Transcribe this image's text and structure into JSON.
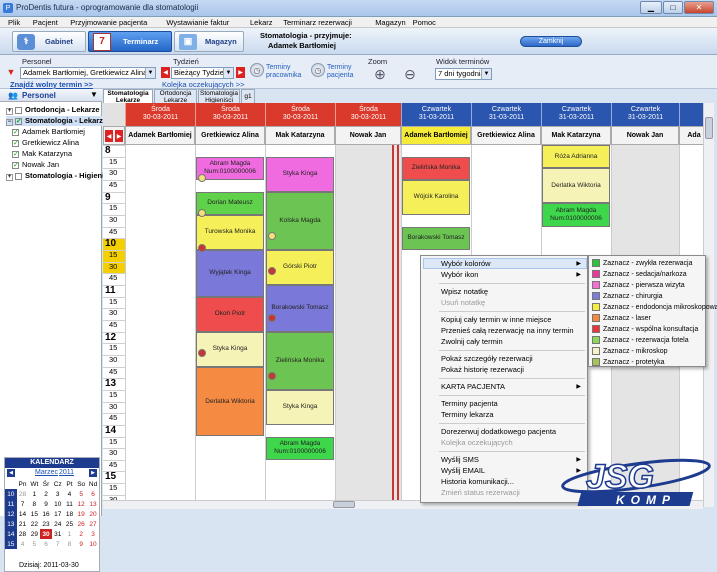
{
  "window": {
    "title": "ProDentis futura - oprogramowanie dla stomatologii"
  },
  "menu": [
    "Plik",
    "Pacjent",
    "Przyjmowanie pacjenta",
    "Wystawianie faktur",
    "Lekarz",
    "Terminarz rezerwacji",
    "Magazyn",
    "Pomoc"
  ],
  "toolbar": {
    "gabinet": "Gabinet",
    "terminarz": "Terminarz",
    "magazyn": "Magazyn",
    "info_label": "Stomatologia - przyjmuje:",
    "info_doctor": "Adamek Bartłomiej",
    "close": "Zamknij"
  },
  "filters": {
    "personel_label": "Personel",
    "personel_value": "Adamek Bartłomiej, Gretkiewicz Alina",
    "tydzien_label": "Tydzień",
    "tydzien_value": "Bieżący Tydzień",
    "terminy_pracownika": "Terminy pracownika",
    "terminy_pacjenta": "Terminy pacjenta",
    "zoom_label": "Zoom",
    "widok_label": "Widok terminów",
    "widok_value": "7 dni tygodnia",
    "find_free": "Znajdź wolny termin >>",
    "kolejka": "Kolejka oczekujących >>"
  },
  "tree": {
    "header": "Personel",
    "items": [
      {
        "label": "Ortodoncja - Lekarze",
        "level": 0,
        "checked": false,
        "bold": true
      },
      {
        "label": "Stomatologia - Lekarze",
        "level": 0,
        "checked": true,
        "bold": true
      },
      {
        "label": "Adamek Bartłomiej",
        "level": 1,
        "checked": true
      },
      {
        "label": "Gretkiewicz Alina",
        "level": 1,
        "checked": true
      },
      {
        "label": "Mak Katarzyna",
        "level": 1,
        "checked": true
      },
      {
        "label": "Nowak Jan",
        "level": 1,
        "checked": true
      },
      {
        "label": "Stomatologia - Higieni",
        "level": 0,
        "checked": false,
        "bold": true
      }
    ]
  },
  "calendar": {
    "title": "KALENDARZ",
    "month": "Marzec",
    "year": "2011",
    "weekdays": [
      "Pn",
      "Wt",
      "Śr",
      "Cz",
      "Pt",
      "So",
      "Nd"
    ],
    "weeks": [
      {
        "wk": "10",
        "days": [
          "28",
          "1",
          "2",
          "3",
          "4",
          "5",
          "6"
        ]
      },
      {
        "wk": "11",
        "days": [
          "7",
          "8",
          "9",
          "10",
          "11",
          "12",
          "13"
        ]
      },
      {
        "wk": "12",
        "days": [
          "14",
          "15",
          "16",
          "17",
          "18",
          "19",
          "20"
        ]
      },
      {
        "wk": "13",
        "days": [
          "21",
          "22",
          "23",
          "24",
          "25",
          "26",
          "27"
        ]
      },
      {
        "wk": "14",
        "days": [
          "28",
          "29",
          "30",
          "31",
          "1",
          "2",
          "3"
        ]
      },
      {
        "wk": "15",
        "days": [
          "4",
          "5",
          "6",
          "7",
          "8",
          "9",
          "10"
        ]
      }
    ],
    "today": "Dzisiaj: 2011-03-30"
  },
  "tabs": [
    "Stomatologia Lekarze",
    "Ortodoncja Lekarze",
    "Stomatologia Higieniści",
    "g1"
  ],
  "days": [
    {
      "name": "Środa",
      "date": "30-03-2011",
      "color": "#d93a2b"
    },
    {
      "name": "Czwartek",
      "date": "31-03-2011",
      "color": "#2a56b0"
    }
  ],
  "columns": [
    "Adamek Bartłomiej",
    "Gretkiewicz Alina",
    "Mak Katarzyna",
    "Nowak Jan",
    "Adamek Bartłomiej",
    "Gretkiewicz Alina",
    "Mak Katarzyna",
    "Nowak Jan",
    "Ada"
  ],
  "times": [
    {
      "h": "8"
    },
    {
      "m": "15"
    },
    {
      "m": "30"
    },
    {
      "m": "45"
    },
    {
      "h": "9"
    },
    {
      "m": "15"
    },
    {
      "m": "30"
    },
    {
      "m": "45"
    },
    {
      "h": "10"
    },
    {
      "m": "15"
    },
    {
      "m": "30"
    },
    {
      "m": "45"
    },
    {
      "h": "11"
    },
    {
      "m": "15"
    },
    {
      "m": "30"
    },
    {
      "m": "45"
    },
    {
      "h": "12"
    },
    {
      "m": "15"
    },
    {
      "m": "30"
    },
    {
      "m": "45"
    },
    {
      "h": "13"
    },
    {
      "m": "15"
    },
    {
      "m": "30"
    },
    {
      "m": "45"
    },
    {
      "h": "14"
    },
    {
      "m": "15"
    },
    {
      "m": "30"
    },
    {
      "m": "45"
    },
    {
      "h": "15"
    },
    {
      "m": "15"
    },
    {
      "m": "30"
    }
  ],
  "appointments": [
    {
      "col": 1,
      "start": 1,
      "len": 2,
      "text": "Abram Magda Num:0100000006",
      "color": "#f06be0"
    },
    {
      "col": 1,
      "start": 4,
      "len": 2,
      "text": "Dorian Mateusz",
      "color": "#5fd14a"
    },
    {
      "col": 1,
      "start": 6,
      "len": 3,
      "text": "Turowska Monika",
      "color": "#f5f05a"
    },
    {
      "col": 1,
      "start": 9,
      "len": 4,
      "text": "Wyjątek Kinga",
      "color": "#7a78d8"
    },
    {
      "col": 1,
      "start": 13,
      "len": 3,
      "text": "Okoń Piotr",
      "color": "#ef4d4d"
    },
    {
      "col": 1,
      "start": 16,
      "len": 3,
      "text": "Styka Kinga",
      "color": "#f6f3b6"
    },
    {
      "col": 1,
      "start": 19,
      "len": 6,
      "text": "Derlatka Wiktoria",
      "color": "#f58b42"
    },
    {
      "col": 2,
      "start": 1,
      "len": 3,
      "text": "Styka Kinga",
      "color": "#f06be0"
    },
    {
      "col": 2,
      "start": 4,
      "len": 5,
      "text": "Kolska Magda",
      "color": "#6cc452"
    },
    {
      "col": 2,
      "start": 9,
      "len": 3,
      "text": "Górski Piotr",
      "color": "#f5f05a"
    },
    {
      "col": 2,
      "start": 12,
      "len": 4,
      "text": "Borakowski Tomasz",
      "color": "#7a78d8"
    },
    {
      "col": 2,
      "start": 16,
      "len": 5,
      "text": "Zielińska Monika",
      "color": "#6cc452"
    },
    {
      "col": 2,
      "start": 21,
      "len": 3,
      "text": "Styka Kinga",
      "color": "#f6f3b6"
    },
    {
      "col": 2,
      "start": 25,
      "len": 2,
      "text": "Abram Magda Num:0100000006",
      "color": "#3ed64a"
    },
    {
      "col": 4,
      "start": 1,
      "len": 2,
      "text": "Zielińska Monika",
      "color": "#ef4d4d"
    },
    {
      "col": 4,
      "start": 3,
      "len": 3,
      "text": "Wójcik Karolina",
      "color": "#f5f05a"
    },
    {
      "col": 4,
      "start": 7,
      "len": 2,
      "text": "Borakowski Tomasz",
      "color": "#6cc452"
    },
    {
      "col": 6,
      "start": 0,
      "len": 2,
      "text": "Róża Adrianna",
      "color": "#f5f05a"
    },
    {
      "col": 6,
      "start": 2,
      "len": 3,
      "text": "Derlatka Wiktoria",
      "color": "#f6f3b6"
    },
    {
      "col": 6,
      "start": 5,
      "len": 2,
      "text": "Abram Magda Num:0100000006",
      "color": "#3ed64a"
    }
  ],
  "context_menu": [
    {
      "label": "Wybór kolorów",
      "arrow": true
    },
    {
      "label": "Wybór ikon",
      "arrow": true
    },
    {
      "sep": true
    },
    {
      "label": "Wpisz notatkę"
    },
    {
      "label": "Usuń notatkę",
      "disabled": true
    },
    {
      "sep": true
    },
    {
      "label": "Kopiuj cały termin w inne miejsce"
    },
    {
      "label": "Przenieś całą rezerwację na inny termin"
    },
    {
      "label": "Zwolnij cały termin"
    },
    {
      "sep": true
    },
    {
      "label": "Pokaż szczegóły rezerwacji"
    },
    {
      "label": "Pokaż historię rezerwacji"
    },
    {
      "sep": true
    },
    {
      "label": "KARTA PACJENTA",
      "arrow": true
    },
    {
      "sep": true
    },
    {
      "label": "Terminy pacjenta"
    },
    {
      "label": "Terminy lekarza"
    },
    {
      "sep": true
    },
    {
      "label": "Dorezerwuj dodatkowego pacjenta"
    },
    {
      "label": "Kolejka oczekujących",
      "disabled": true
    },
    {
      "sep": true
    },
    {
      "label": "Wyślij SMS",
      "arrow": true
    },
    {
      "label": "Wyślij EMAIL",
      "arrow": true
    },
    {
      "label": "Historia komunikacji..."
    },
    {
      "label": "Zmień status rezerwacji",
      "disabled": true
    }
  ],
  "submenu": [
    {
      "label": "Zaznacz - zwykła rezerwacja",
      "color": "#2ec23a"
    },
    {
      "label": "Zaznacz - sedacja/narkoza",
      "color": "#e8389a"
    },
    {
      "label": "Zaznacz - pierwsza wizyta",
      "color": "#f36fd4"
    },
    {
      "label": "Zaznacz - chirurgia",
      "color": "#7b7fd6"
    },
    {
      "label": "Zaznacz - endodoncja mikroskopowa",
      "color": "#f5ee3a"
    },
    {
      "label": "Zaznacz - laser",
      "color": "#f58a3a"
    },
    {
      "label": "Zaznacz - wspólna konsultacja",
      "color": "#e8343a"
    },
    {
      "label": "Zaznacz - rezerwacja fotela",
      "color": "#8ad85a"
    },
    {
      "label": "Zaznacz - mikroskop",
      "color": "#f4f2c8"
    },
    {
      "label": "Zaznacz - protetyka",
      "color": "#a8c25a"
    }
  ],
  "logo": {
    "line1": "JSG",
    "line2": "KOMP"
  }
}
